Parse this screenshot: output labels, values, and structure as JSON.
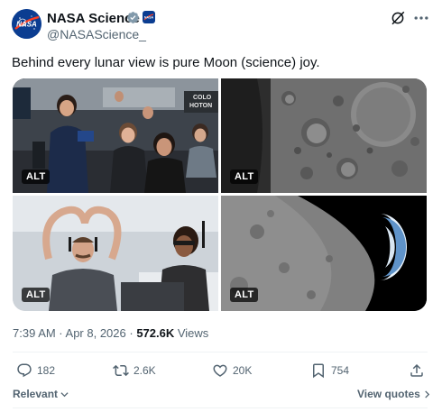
{
  "account": {
    "name": "NASA Science",
    "handle": "@NASAScience_",
    "avatar_icon": "nasa-meatball-logo",
    "brand_color": "#0b3d91",
    "verified_color": "#829aab"
  },
  "header_actions": {
    "grok_icon": "grok-icon",
    "more_icon": "more-options-icon"
  },
  "tweet": {
    "text": "Behind every lunar view is pure Moon (science) joy."
  },
  "media": {
    "tiles": [
      {
        "alt_label": "ALT",
        "subject": "mission-control-team-photo"
      },
      {
        "alt_label": "ALT",
        "subject": "lunar-crater-closeup"
      },
      {
        "alt_label": "ALT",
        "subject": "team-heart-hands-photo"
      },
      {
        "alt_label": "ALT",
        "subject": "moon-limb-and-earth-crescent"
      }
    ]
  },
  "meta": {
    "timestamp": "7:39 AM · Apr 8, 2026 · ",
    "views_count": "572.6K",
    "views_label": " Views"
  },
  "actions": {
    "replies": "182",
    "reposts": "2.6K",
    "likes": "20K",
    "bookmarks": "754"
  },
  "footer": {
    "sort_label": "Relevant",
    "view_quotes_label": "View quotes"
  }
}
